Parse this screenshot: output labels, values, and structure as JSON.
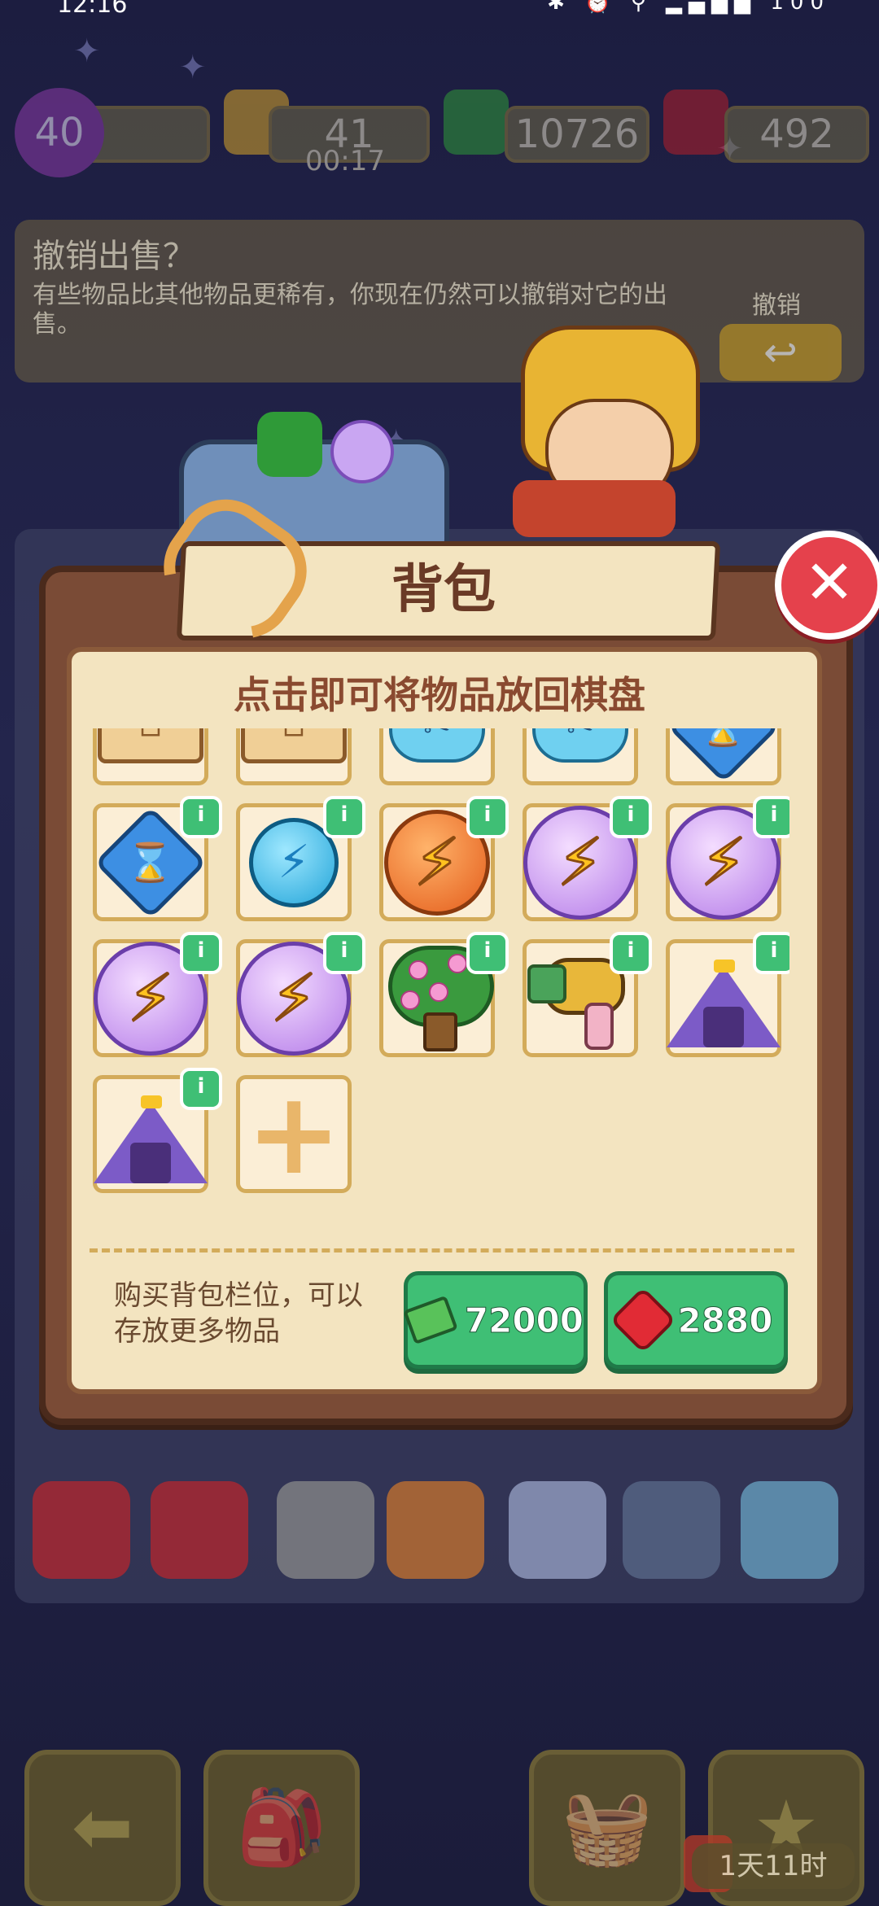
{
  "status_bar": {
    "time": "12:16",
    "icons": "✱ ⏰ ⚲ ▂▄▆█ 100"
  },
  "resources": {
    "level": "40",
    "energy": "41",
    "energy_timer": "00:17",
    "cash": "10726",
    "gems": "492"
  },
  "undo_sale": {
    "title": "撤销出售？",
    "description": "有些物品比其他物品更稀有，你现在仍然可以撤销对它的出售。",
    "button_label": "撤销",
    "button_icon": "↩"
  },
  "modal": {
    "title": "背包",
    "close_glyph": "✕",
    "hint": "点击即可将物品放回棋盘",
    "info_glyph": "i",
    "cells": [
      {
        "item": "box",
        "glyph": "⊟",
        "info": false
      },
      {
        "item": "box",
        "glyph": "⊟",
        "info": false
      },
      {
        "item": "cloud",
        "glyph": "✂",
        "info": false
      },
      {
        "item": "cloud",
        "glyph": "✂",
        "info": false
      },
      {
        "item": "diamond",
        "glyph": "⌛",
        "info": false
      },
      {
        "item": "diamond",
        "glyph": "⌛",
        "info": true
      },
      {
        "item": "orb-blue",
        "glyph": "⚡",
        "info": true
      },
      {
        "item": "orb-orange",
        "glyph": "⚡",
        "info": true
      },
      {
        "item": "orb-purple",
        "glyph": "⚡",
        "info": true
      },
      {
        "item": "orb-purple",
        "glyph": "⚡",
        "info": true
      },
      {
        "item": "orb-purple",
        "glyph": "⚡",
        "info": true
      },
      {
        "item": "orb-purple",
        "glyph": "⚡",
        "info": true
      },
      {
        "item": "tree",
        "glyph": "",
        "info": true
      },
      {
        "item": "dryer",
        "glyph": "",
        "info": true
      },
      {
        "item": "tent",
        "glyph": "",
        "info": true
      },
      {
        "item": "tent",
        "glyph": "",
        "info": true
      },
      {
        "item": "plus",
        "glyph": "+",
        "info": false
      }
    ],
    "buy_description": "购买背包栏位，可以存放更多物品",
    "buy_cash_value": "72000",
    "buy_gem_value": "2880"
  },
  "bottom": {
    "back_icon": "⬅",
    "backpack_icon": "🎒",
    "basket_icon": "🧺",
    "tasks_icon": "★",
    "timer": "1天11时"
  },
  "colors": {
    "accent_green": "#3fbf75",
    "close_red": "#e5414c",
    "panel": "#f3e4c0",
    "modal_brown": "#7a4b36"
  }
}
